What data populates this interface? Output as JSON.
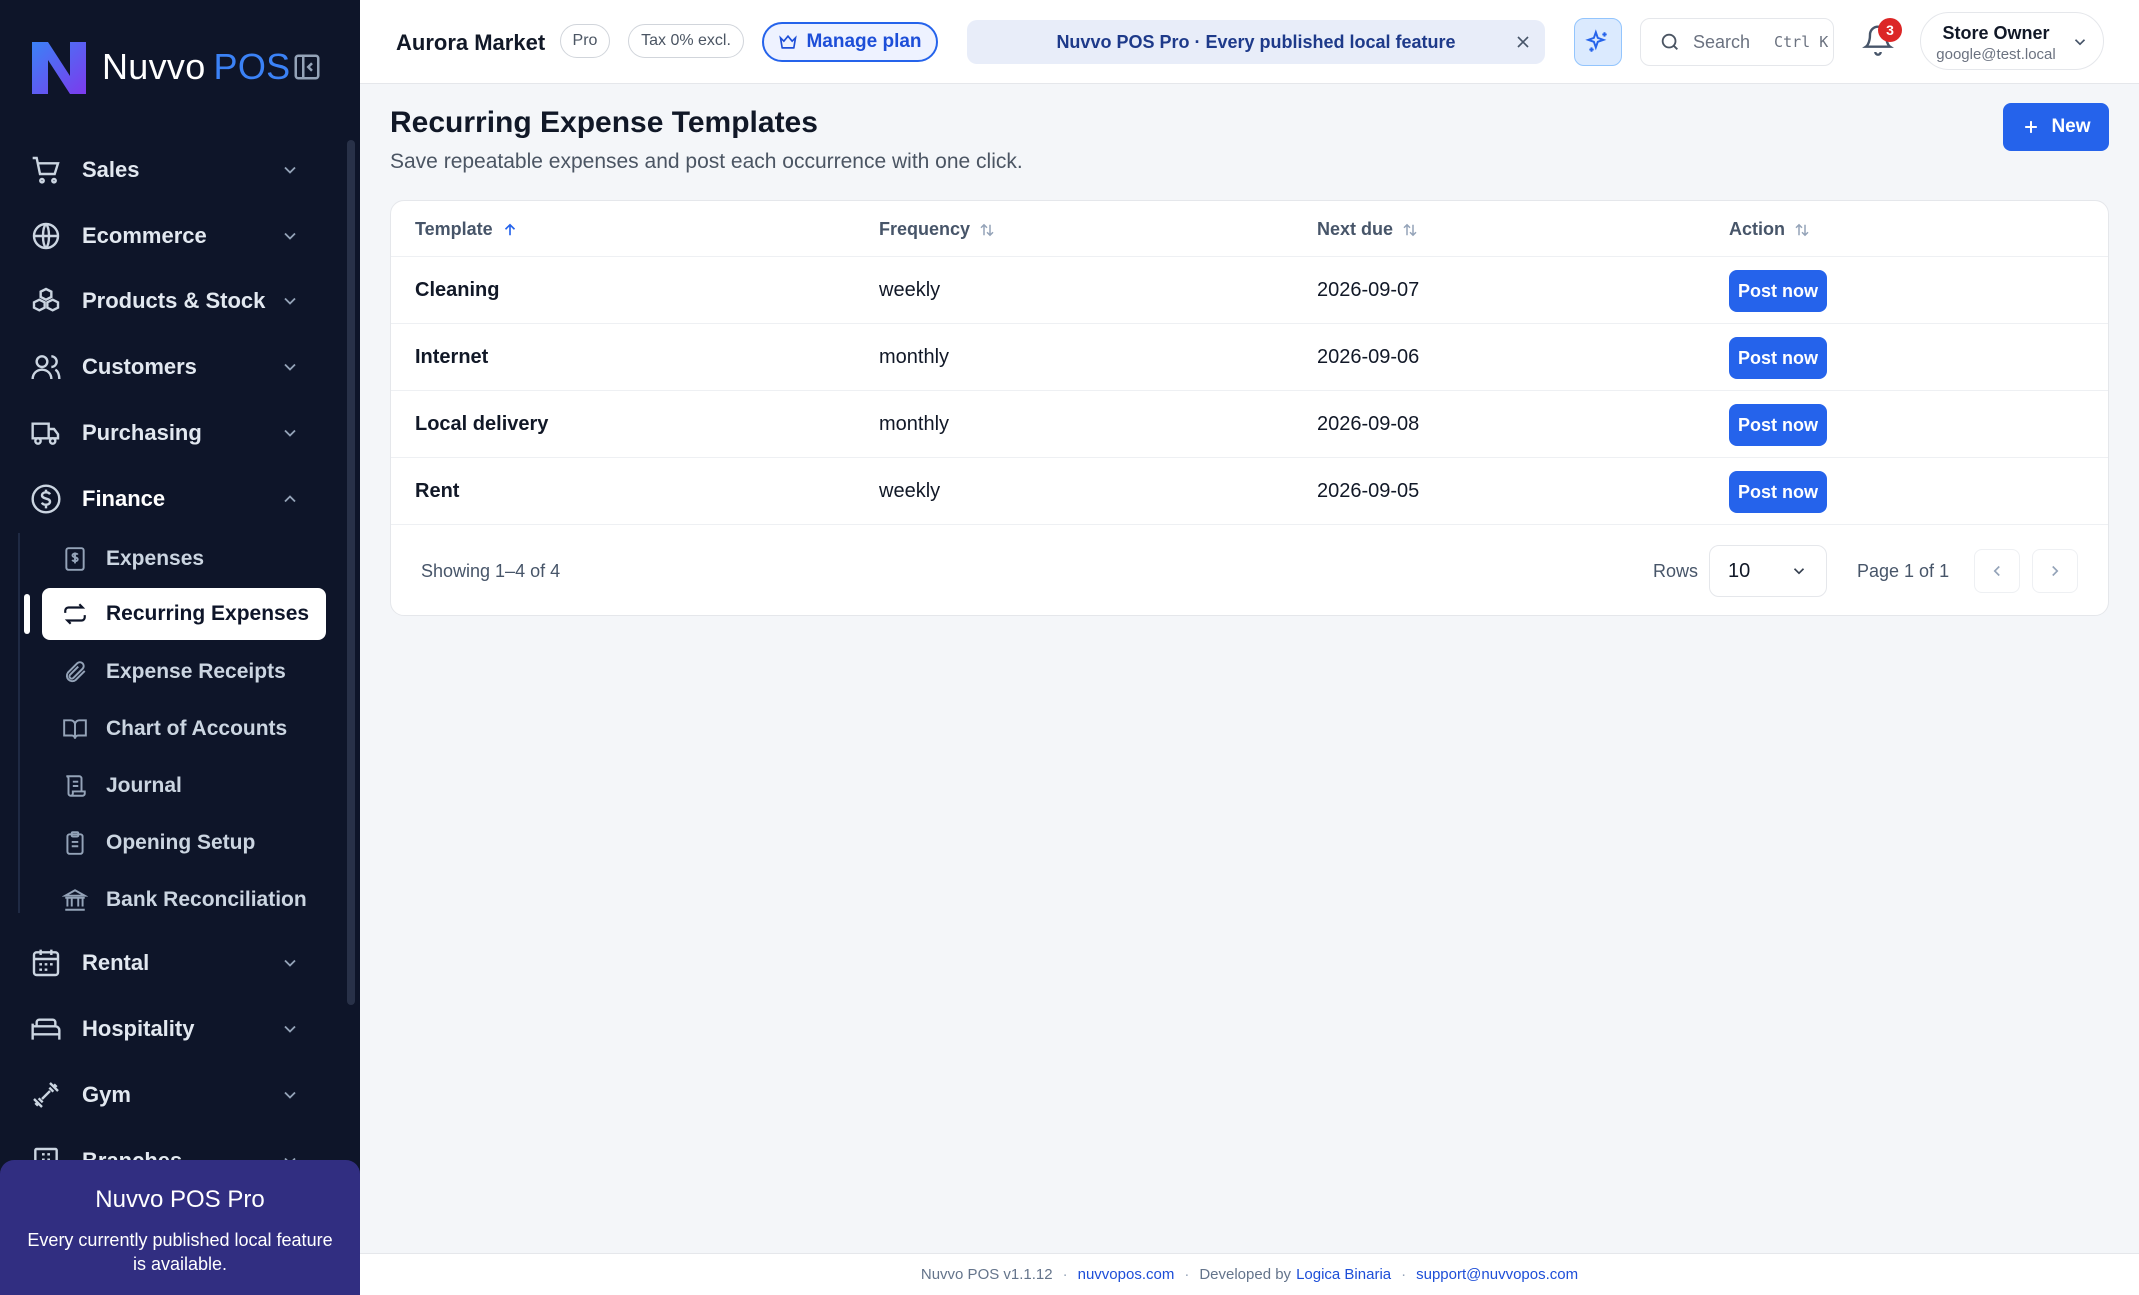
{
  "brand": {
    "name": "Nuvvo",
    "suffix": "POS"
  },
  "sidebar": {
    "groups": [
      {
        "label": "Sales",
        "icon": "cart-icon"
      },
      {
        "label": "Ecommerce",
        "icon": "globe-icon"
      },
      {
        "label": "Products & Stock",
        "icon": "boxes-icon"
      },
      {
        "label": "Customers",
        "icon": "users-icon"
      },
      {
        "label": "Purchasing",
        "icon": "truck-icon"
      },
      {
        "label": "Finance",
        "icon": "dollar-circle-icon",
        "expanded": true
      },
      {
        "label": "Rental",
        "icon": "calendar-icon"
      },
      {
        "label": "Hospitality",
        "icon": "bed-icon"
      },
      {
        "label": "Gym",
        "icon": "dumbbell-icon"
      },
      {
        "label": "Branches",
        "icon": "building-icon"
      }
    ],
    "finance_items": [
      {
        "label": "Expenses",
        "icon": "receipt-icon"
      },
      {
        "label": "Recurring Expenses",
        "icon": "repeat-icon",
        "active": true
      },
      {
        "label": "Expense Receipts",
        "icon": "paperclip-icon"
      },
      {
        "label": "Chart of Accounts",
        "icon": "book-icon"
      },
      {
        "label": "Journal",
        "icon": "scroll-icon"
      },
      {
        "label": "Opening Setup",
        "icon": "clipboard-icon"
      },
      {
        "label": "Bank Reconciliation",
        "icon": "bank-icon"
      }
    ],
    "promo": {
      "title": "Nuvvo POS Pro",
      "text": "Every currently published local feature is available."
    }
  },
  "header": {
    "store_name": "Aurora Market",
    "plan_badge": "Pro",
    "tax_badge": "Tax 0% excl.",
    "manage_plan": "Manage plan",
    "banner": "Nuvvo POS Pro · Every published local feature",
    "search_placeholder": "Search",
    "search_shortcut": "Ctrl K",
    "notifications_count": "3",
    "user_name": "Store Owner",
    "user_email": "google@test.local"
  },
  "page": {
    "title": "Recurring Expense Templates",
    "subtitle": "Save repeatable expenses and post each occurrence with one click.",
    "new_button": "New"
  },
  "table": {
    "columns": [
      "Template",
      "Frequency",
      "Next due",
      "Action"
    ],
    "sort": {
      "column": "Template",
      "direction": "asc"
    },
    "rows": [
      {
        "template": "Cleaning",
        "frequency": "weekly",
        "next_due": "2026-09-07",
        "action": "Post now"
      },
      {
        "template": "Internet",
        "frequency": "monthly",
        "next_due": "2026-09-06",
        "action": "Post now"
      },
      {
        "template": "Local delivery",
        "frequency": "monthly",
        "next_due": "2026-09-08",
        "action": "Post now"
      },
      {
        "template": "Rent",
        "frequency": "weekly",
        "next_due": "2026-09-05",
        "action": "Post now"
      }
    ],
    "showing": "Showing 1–4 of 4",
    "rows_label": "Rows",
    "rows_per_page": "10",
    "page_info": "Page 1 of 1"
  },
  "footer": {
    "version": "Nuvvo POS v1.1.12",
    "site": "nuvvopos.com",
    "developed_by": "Developed by",
    "developer": "Logica Binaria",
    "support": "support@nuvvopos.com"
  },
  "colors": {
    "sidebar_bg": "#0e1529",
    "accent": "#2563eb",
    "promo_bg": "#312e81",
    "badge": "#dc2626"
  }
}
